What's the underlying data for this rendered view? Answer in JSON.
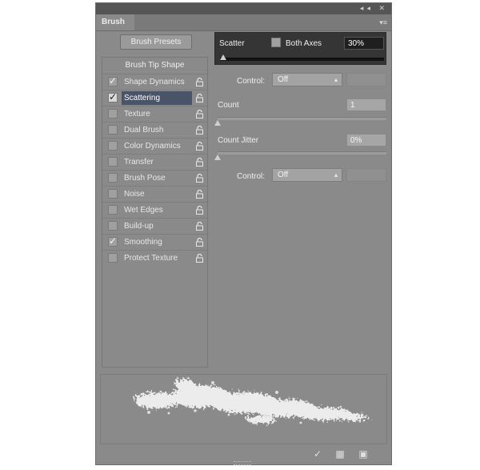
{
  "panel": {
    "tab_label": "Brush",
    "presets_button": "Brush Presets",
    "tip_shape_label": "Brush Tip Shape"
  },
  "options": [
    {
      "label": "Shape Dynamics",
      "checked": true,
      "selected": false
    },
    {
      "label": "Scattering",
      "checked": true,
      "selected": true
    },
    {
      "label": "Texture",
      "checked": false,
      "selected": false
    },
    {
      "label": "Dual Brush",
      "checked": false,
      "selected": false
    },
    {
      "label": "Color Dynamics",
      "checked": false,
      "selected": false
    },
    {
      "label": "Transfer",
      "checked": false,
      "selected": false
    },
    {
      "label": "Brush Pose",
      "checked": false,
      "selected": false
    },
    {
      "label": "Noise",
      "checked": false,
      "selected": false
    },
    {
      "label": "Wet Edges",
      "checked": false,
      "selected": false
    },
    {
      "label": "Build-up",
      "checked": false,
      "selected": false
    },
    {
      "label": "Smoothing",
      "checked": true,
      "selected": false
    },
    {
      "label": "Protect Texture",
      "checked": false,
      "selected": false
    }
  ],
  "scatter": {
    "label": "Scatter",
    "both_axes_label": "Both Axes",
    "both_axes_checked": false,
    "value": "30%",
    "slider_fraction": 0.0,
    "control_label": "Control:",
    "control_value": "Off"
  },
  "count": {
    "label": "Count",
    "value": "1",
    "slider_fraction": 0.0
  },
  "count_jitter": {
    "label": "Count Jitter",
    "value": "0%",
    "slider_fraction": 0.0,
    "control_label": "Control:",
    "control_value": "Off"
  },
  "colors": {
    "panel_bg": "#8a8a8a",
    "selected_row": "#4a5469",
    "highlight_box": "#353535"
  }
}
